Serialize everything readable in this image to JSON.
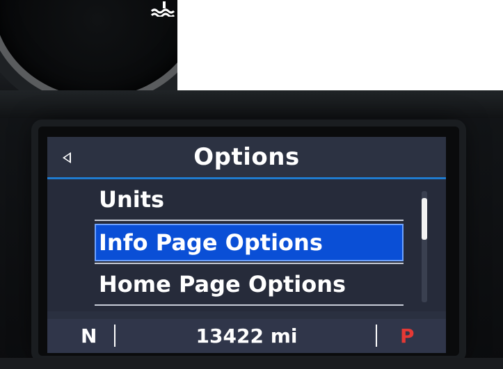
{
  "screen": {
    "title": "Options",
    "menu_items": [
      {
        "label": "Units",
        "selected": false
      },
      {
        "label": "Info Page Options",
        "selected": true
      },
      {
        "label": "Home Page Options",
        "selected": false
      }
    ],
    "scroll_position": 0.1
  },
  "status_bar": {
    "gear_indicator": "N",
    "odometer": "13422 mi",
    "park_indicator": "P"
  },
  "colors": {
    "selection": "#0a4fd6",
    "header_underline": "#1f7cd0",
    "park_indicator": "#e53935",
    "text": "#ffffff"
  },
  "icons": {
    "back": "back-arrow-icon",
    "gauge_warning": "coolant-temperature-icon"
  }
}
